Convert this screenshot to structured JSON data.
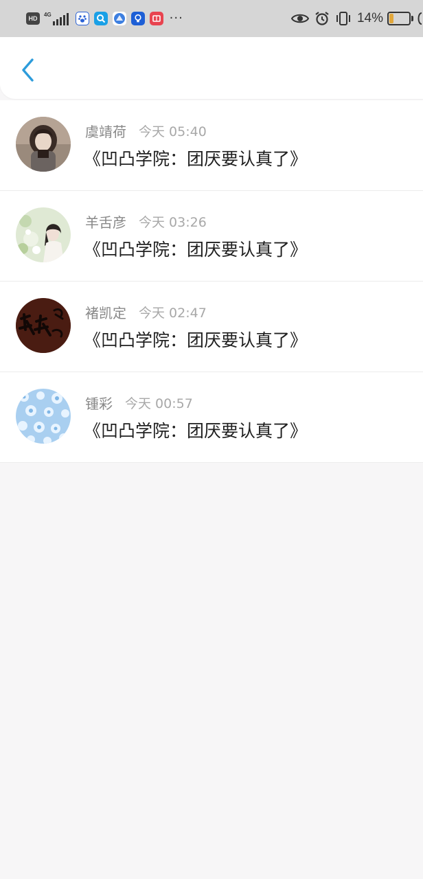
{
  "status_bar": {
    "hd": "HD",
    "network": "4G",
    "more": "···",
    "battery_percent": "14%",
    "battery_level": 0.14,
    "icons": [
      "baidu-paw-icon",
      "search-app-icon",
      "browser-app-icon",
      "bulb-app-icon",
      "book-app-icon",
      "eye-icon",
      "alarm-icon",
      "vibrate-icon"
    ]
  },
  "colors": {
    "accent": "#2d9cdb",
    "name_gray": "#888888",
    "time_gray": "#a8a8a8",
    "text_dark": "#1f1f1f",
    "battery_fill": "#e2a73a"
  },
  "header": {
    "back_icon": "chevron-left-icon"
  },
  "items": [
    {
      "name": "虞靖荷",
      "time": "今天 05:40",
      "message": "《凹凸学院：团厌要认真了》",
      "avatar": "avatar-girl-dark"
    },
    {
      "name": "羊舌彦",
      "time": "今天 03:26",
      "message": "《凹凸学院：团厌要认真了》",
      "avatar": "avatar-girl-flowers"
    },
    {
      "name": "褚凯定",
      "time": "今天 02:47",
      "message": "《凹凸学院：团厌要认真了》",
      "avatar": "avatar-calligraphy"
    },
    {
      "name": "锺彩",
      "time": "今天 00:57",
      "message": "《凹凸学院：团厌要认真了》",
      "avatar": "avatar-snowflakes"
    }
  ]
}
